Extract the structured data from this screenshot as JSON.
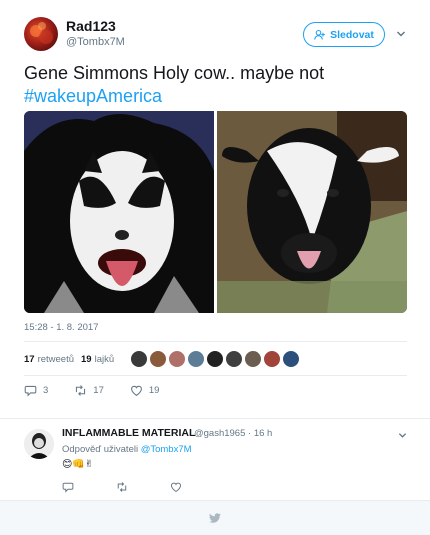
{
  "tweet": {
    "author_name": "Rad123",
    "author_handle": "@Tombx7M",
    "follow_label": "Sledovat",
    "text": "Gene Simmons Holy cow.. maybe not",
    "hashtag": "#wakeupAmerica",
    "timestamp": "15:28 - 1. 8. 2017",
    "retweets_count": "17",
    "retweets_label": "retweetů",
    "likes_count": "19",
    "likes_label": "lajků",
    "actions": {
      "reply_count": "3",
      "retweet_count": "17",
      "like_count": "19"
    },
    "icons": [
      "chevron-down-icon",
      "follow-person-icon",
      "reply-icon",
      "retweet-icon",
      "like-icon"
    ],
    "liker_colors": [
      "#3a3a3a",
      "#8a5a3c",
      "#b0706a",
      "#5c7d95",
      "#222",
      "#404040",
      "#6b5d4f",
      "#a1443a",
      "#2d4f7c"
    ]
  },
  "reply": {
    "author_name": "INFLAMMABLE MATERIAL",
    "author_handle": "@gash1965",
    "time": "16 h",
    "reply_prefix": "Odpověď uživateli",
    "reply_mention": "@Tombx7M",
    "emojis": "😊👊✌"
  },
  "colors": {
    "accent": "#1da1f2",
    "muted": "#657786",
    "text": "#14171a",
    "border": "#e6ecf0"
  }
}
